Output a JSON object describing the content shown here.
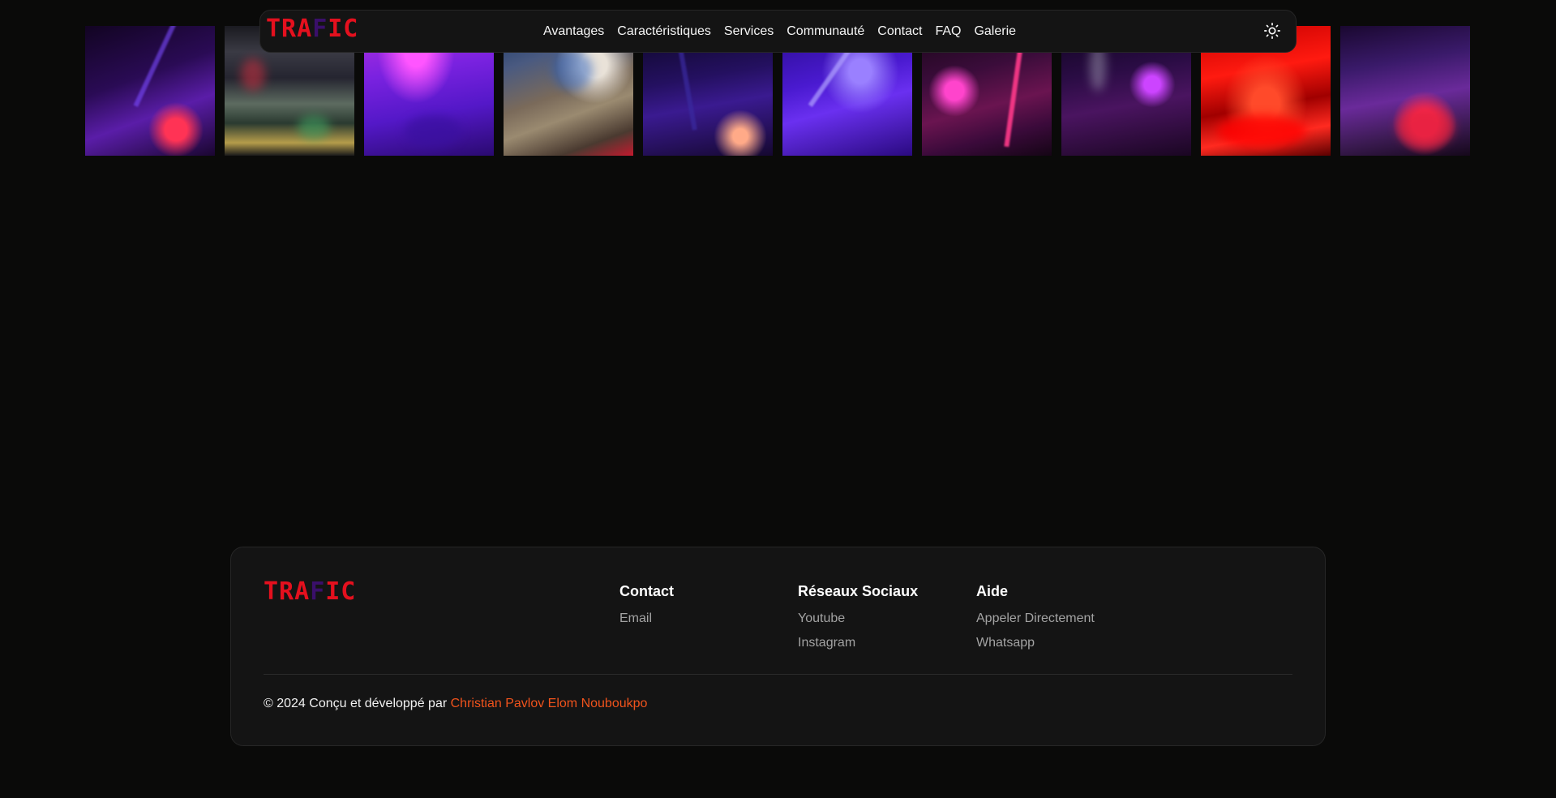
{
  "brand": {
    "logo_left": "TRA",
    "logo_mid": "F",
    "logo_right": "IC",
    "logo_color": "#e4101e"
  },
  "nav": {
    "links": [
      {
        "label": "Avantages"
      },
      {
        "label": "Caractéristiques"
      },
      {
        "label": "Services"
      },
      {
        "label": "Communauté"
      },
      {
        "label": "Contact"
      },
      {
        "label": "FAQ"
      },
      {
        "label": "Galerie"
      }
    ],
    "theme_toggle_icon": "sun-icon"
  },
  "gallery": {
    "count": 10
  },
  "footer": {
    "columns": [
      {
        "title": "Contact",
        "links": [
          "Email"
        ]
      },
      {
        "title": "Réseaux Sociaux",
        "links": [
          "Youtube",
          "Instagram"
        ]
      },
      {
        "title": "Aide",
        "links": [
          "Appeler Directement",
          "Whatsapp"
        ]
      }
    ],
    "copyright_prefix": "© 2024 Conçu et développé par ",
    "author": "Christian Pavlov Elom Nouboukpo",
    "author_color": "#f0531c"
  }
}
